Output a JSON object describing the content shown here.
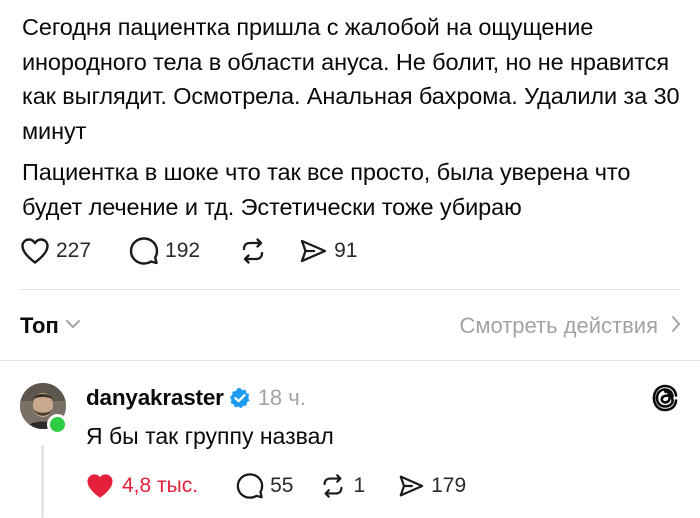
{
  "post": {
    "paragraphs": [
      "Сегодня пациентка пришла с жалобой на ощущение инородного тела в области ануса. Не болит, но не нравится как выглядит. Осмотрела. Анальная бахрома. Удалили за 30 минут",
      "Пациентка в шоке что так все просто, была уверена что будет лечение и тд. Эстетически тоже убираю"
    ],
    "actions": {
      "likes": "227",
      "replies": "192",
      "reposts": "",
      "shares": "91"
    }
  },
  "replies_header": {
    "sort_label": "Топ",
    "view_activity_label": "Смотреть действия"
  },
  "comment": {
    "username": "danyakraster",
    "verified": true,
    "time": "18 ч.",
    "text": "Я бы так группу назвал",
    "actions": {
      "likes": "4,8 тыс.",
      "liked": true,
      "replies": "55",
      "reposts": "1",
      "shares": "179"
    }
  },
  "colors": {
    "like_red": "#e5203a",
    "verified_blue": "#1d9bf0",
    "online_green": "#2ecc40",
    "muted_text": "#a3a3a3"
  },
  "icons": [
    "heart-icon",
    "comment-bubble-icon",
    "repost-icon",
    "share-send-icon",
    "chevron-down-icon",
    "chevron-right-icon",
    "verified-badge-icon",
    "threads-logo-icon"
  ]
}
